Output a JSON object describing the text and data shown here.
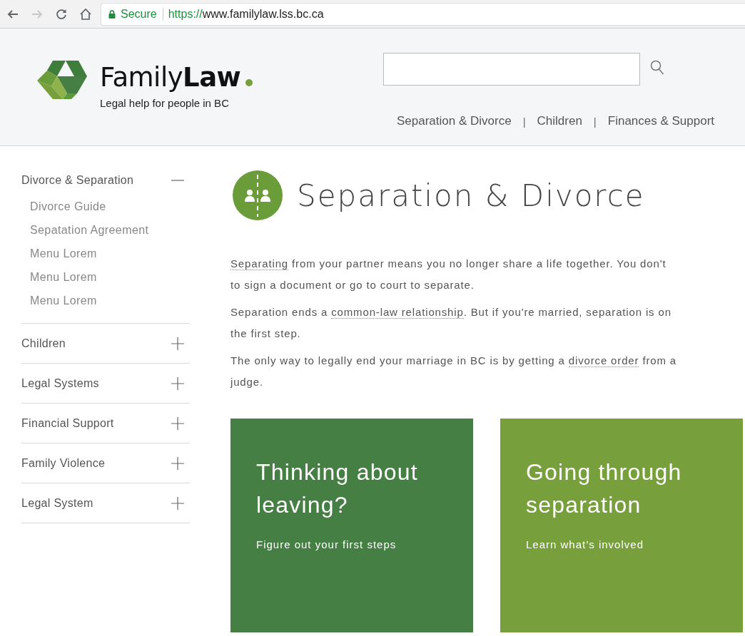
{
  "browser": {
    "forward_disabled": true,
    "secure_label": "Secure",
    "url_scheme": "https://",
    "url_host": "www.familylaw.lss.bc.ca"
  },
  "header": {
    "logo_name": "Family",
    "logo_name_bold": "Law",
    "tagline": "Legal help for people in BC",
    "nav": [
      {
        "label": "Separation & Divorce"
      },
      {
        "label": "Children"
      },
      {
        "label": "Finances & Support"
      }
    ],
    "nav_separator": "|"
  },
  "sidebar": {
    "items": [
      {
        "label": "Divorce & Separation",
        "expanded": true,
        "children": [
          {
            "label": "Divorce Guide"
          },
          {
            "label": "Sepatation Agreement"
          },
          {
            "label": "Menu Lorem"
          },
          {
            "label": "Menu Lorem"
          },
          {
            "label": "Menu Lorem"
          }
        ]
      },
      {
        "label": "Children",
        "expanded": false
      },
      {
        "label": "Legal Systems",
        "expanded": false
      },
      {
        "label": "Financial Support",
        "expanded": false
      },
      {
        "label": "Family Violence",
        "expanded": false
      },
      {
        "label": "Legal System",
        "expanded": false
      }
    ]
  },
  "main": {
    "title": "Separation & Divorce",
    "paragraphs": [
      {
        "lines": [
          [
            {
              "kind": "link",
              "text": "Separating"
            },
            {
              "kind": "text",
              "text": " from your partner means you no longer share a life together. You don't"
            }
          ],
          [
            {
              "kind": "text",
              "text": "to sign a document or go to court to separate."
            }
          ]
        ]
      },
      {
        "lines": [
          [
            {
              "kind": "text",
              "text": "Separation ends a "
            },
            {
              "kind": "link",
              "text": "common-law relationship"
            },
            {
              "kind": "text",
              "text": ". But if you're married, separation is on"
            }
          ],
          [
            {
              "kind": "text",
              "text": "the first step."
            }
          ]
        ]
      },
      {
        "lines": [
          [
            {
              "kind": "text",
              "text": "The only way to legally end your marriage in BC is by getting a "
            },
            {
              "kind": "link",
              "text": "divorce order"
            },
            {
              "kind": "text",
              "text": " from a"
            }
          ],
          [
            {
              "kind": "text",
              "text": "judge."
            }
          ]
        ]
      }
    ],
    "cards": [
      {
        "title": "Thinking about leaving?",
        "subtitle": "Figure out your first steps",
        "color": "#467f44"
      },
      {
        "title": "Going through separation",
        "subtitle": "Learn what’s involved",
        "color": "#77a03c"
      }
    ]
  }
}
